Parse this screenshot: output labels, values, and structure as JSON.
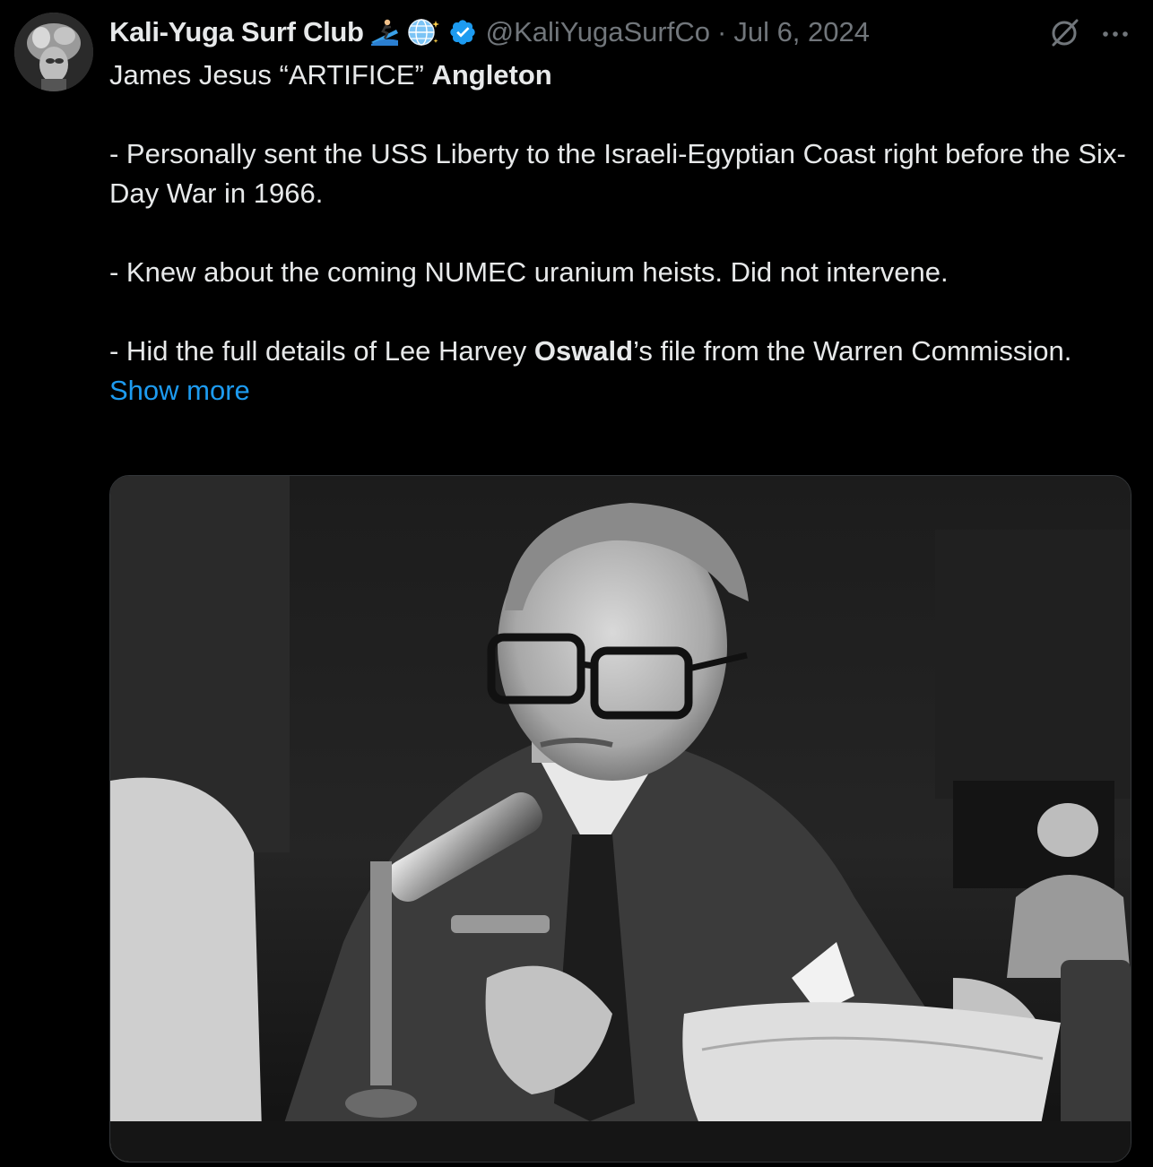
{
  "tweet": {
    "author": {
      "name": "Kali-Yuga Surf Club",
      "name_emojis": [
        "surfer-icon",
        "globe-icon"
      ],
      "verified": true,
      "handle": "@KaliYugaSurfCo",
      "separator": "·",
      "date": "Jul 6, 2024"
    },
    "title": {
      "part1": "James Jesus “ARTIFICE” ",
      "part2": "Angleton"
    },
    "bullets": {
      "b1": "- Personally sent the USS Liberty to the Israeli-Egyptian Coast right before the Six-Day War in 1966.",
      "b2": "- Knew about the coming NUMEC uranium heists. Did not intervene.",
      "b3_pre": "- Hid the full details of Lee Harvey ",
      "b3_bold": "Oswald",
      "b3_post": "’s file from the Warren Commission."
    },
    "show_more": "Show more",
    "icons": {
      "grok": "grok-icon",
      "more": "more-icon",
      "verified": "verified-badge-icon"
    },
    "colors": {
      "background": "#000000",
      "text": "#e7e9ea",
      "muted": "#71767b",
      "link": "#1d9bf0",
      "verified": "#1d9bf0"
    }
  }
}
